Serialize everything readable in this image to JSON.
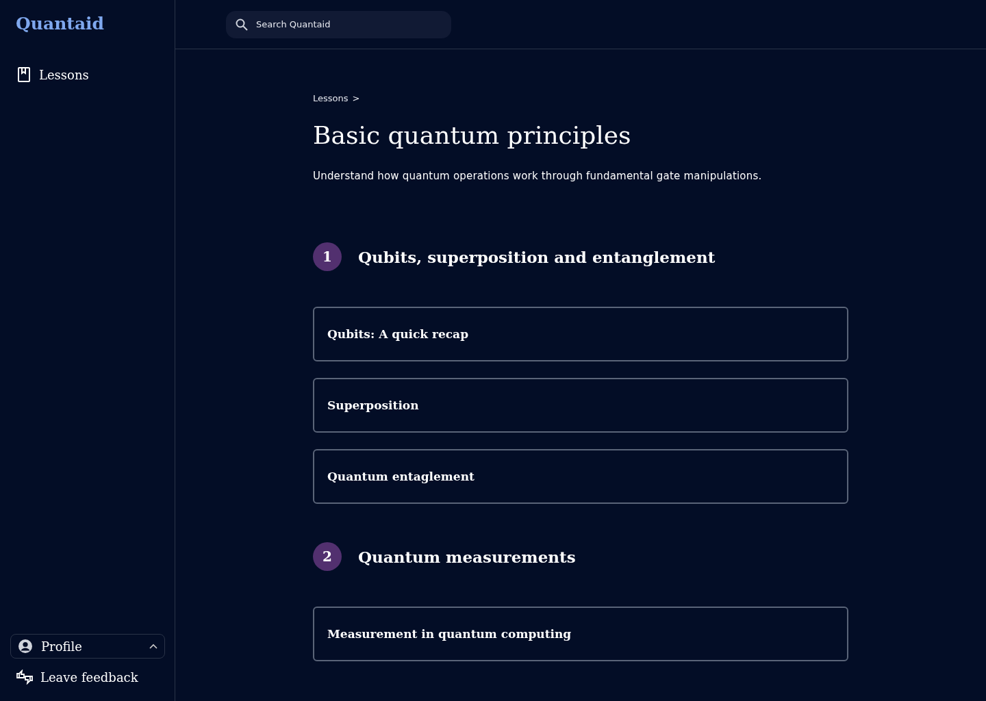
{
  "logo": "Quantaid",
  "sidebar": {
    "items": [
      {
        "label": "Lessons",
        "selected": false
      }
    ]
  },
  "profile": {
    "label": "Profile",
    "expanded": true
  },
  "feedback": {
    "label": "Leave feedback"
  },
  "search": {
    "placeholder": "Search Quantaid"
  },
  "breadcrumb": [
    "Lessons",
    ">"
  ],
  "title": "Basic quantum principles",
  "subtitle": "Understand how quantum operations work through fundamental gate manipulations.",
  "sections": [
    {
      "number": "1",
      "title": "Qubits, superposition and entanglement",
      "lessons": [
        "Qubits: A quick recap",
        "Superposition",
        "Quantum entaglement"
      ]
    },
    {
      "number": "2",
      "title": "Quantum measurements",
      "lessons": [
        "Measurement in quantum computing"
      ]
    }
  ]
}
